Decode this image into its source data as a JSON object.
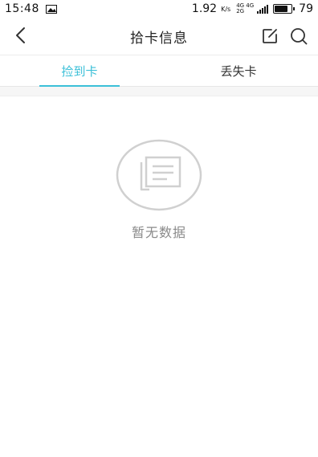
{
  "status_bar": {
    "time": "15:48",
    "speed": "1.92",
    "speed_unit": "K/s",
    "net_top": "4G 4G",
    "net_bottom": "2G",
    "battery_level": "79",
    "icons": [
      "image-icon",
      "signal-icon",
      "battery-icon"
    ]
  },
  "header": {
    "title": "拾卡信息",
    "icons": [
      "back-arrow-icon",
      "edit-icon",
      "search-icon"
    ]
  },
  "tabs": [
    {
      "label": "捡到卡",
      "active": true
    },
    {
      "label": "丢失卡",
      "active": false
    }
  ],
  "colors": {
    "accent": "#3cc0d8",
    "empty_text": "#8a8a8a",
    "empty_icon": "#d0d0d0"
  },
  "empty_state": {
    "message": "暂无数据",
    "icon": "document-list-icon"
  }
}
